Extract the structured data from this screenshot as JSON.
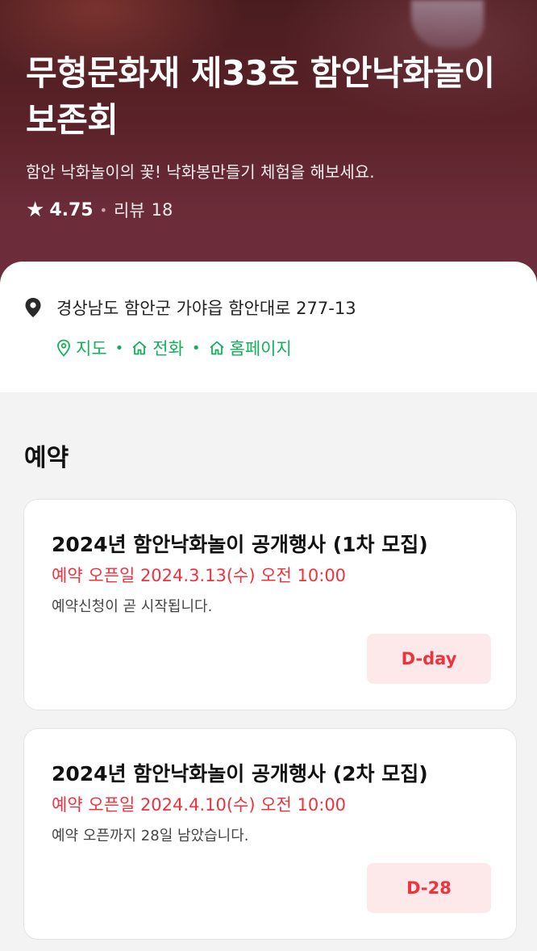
{
  "hero": {
    "title": "무형문화재 제33호 함안낙화놀이보존회",
    "subtitle": "함안 낙화놀이의 꽃! 낙화봉만들기 체험을 해보세요.",
    "rating": "4.75",
    "review_label": "리뷰",
    "review_count": "18"
  },
  "info": {
    "address": "경상남도 함안군 가야읍 함안대로 277-13",
    "links": [
      {
        "label": "지도",
        "icon": "location-icon"
      },
      {
        "label": "전화",
        "icon": "home-icon"
      },
      {
        "label": "홈페이지",
        "icon": "home-icon"
      }
    ],
    "link_color": "#12b05a"
  },
  "reservation": {
    "section_title": "예약",
    "items": [
      {
        "title": "2024년 함안낙화놀이 공개행사 (1차 모집)",
        "open_date": "예약 오픈일 2024.3.13(수) 오전 10:00",
        "status": "예약신청이 곧 시작됩니다.",
        "badge": "D-day"
      },
      {
        "title": "2024년 함안낙화놀이 공개행사 (2차 모집)",
        "open_date": "예약 오픈일 2024.4.10(수) 오전 10:00",
        "status": "예약 오픈까지 28일 남았습니다.",
        "badge": "D-28"
      }
    ],
    "accent_color": "#f0323c"
  }
}
